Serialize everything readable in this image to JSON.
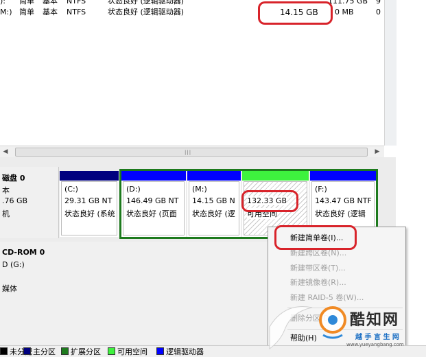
{
  "volumes": [
    {
      "name": "):",
      "layout": "简单",
      "type": "基本",
      "fs": "NTFS",
      "status": "状态良好 (逻辑驱动器)",
      "capacity": "",
      "free": "111.75 GB",
      "pct": "9"
    },
    {
      "name": "M:)",
      "layout": "简单",
      "type": "基本",
      "fs": "NTFS",
      "status": "状态良好 (逻辑驱动器)",
      "capacity": "14.15 GB",
      "free": "0 MB",
      "pct": "0"
    }
  ],
  "disks": {
    "disk0": {
      "title": "磁盘 0",
      "line1": "本",
      "line2": ".76 GB",
      "line3": "机"
    },
    "cdrom": {
      "title": "CD-ROM 0",
      "line1": "D (G:)",
      "line2": "",
      "line3": "媒体"
    }
  },
  "partitions": [
    {
      "label": "(C:)",
      "size": "29.31 GB NT",
      "status": "状态良好 (系统"
    },
    {
      "label": "(D:)",
      "size": "146.49 GB NT",
      "status": "状态良好 (页面"
    },
    {
      "label": "(M:)",
      "size": "14.15 GB N",
      "status": "状态良好 (逻"
    },
    {
      "label": "",
      "size": "132.33 GB",
      "status": "可用空间"
    },
    {
      "label": "(F:)",
      "size": "143.47 GB NTF",
      "status": "状态良好 (逻辑"
    }
  ],
  "context_menu": {
    "items": [
      {
        "label": "新建简单卷(I)...",
        "enabled": true
      },
      {
        "label": "新建跨区卷(N)...",
        "enabled": false
      },
      {
        "label": "新建带区卷(T)...",
        "enabled": false
      },
      {
        "label": "新建镜像卷(R)...",
        "enabled": false
      },
      {
        "label": "新建 RAID-5 卷(W)...",
        "enabled": false
      },
      {
        "label": "删除分区(D)",
        "enabled": false
      },
      {
        "label": "帮助(H)",
        "enabled": true
      }
    ]
  },
  "legend": [
    {
      "label": "未分配",
      "color": "#000000"
    },
    {
      "label": "主分区",
      "color": "#00007f"
    },
    {
      "label": "扩展分区",
      "color": "#1d7a1d"
    },
    {
      "label": "可用空间",
      "color": "#3ef23e"
    },
    {
      "label": "逻辑驱动器",
      "color": "#0000ff"
    }
  ],
  "watermark": {
    "brand": "酷知网",
    "tagline": "越 手 言 生 网",
    "url": "www.yueyangbang.com"
  },
  "colors": {
    "primary_bar": "#00007f",
    "logical_bar": "#0000ff",
    "free_bar": "#3ef23e",
    "extended_border": "#1d7a1d",
    "highlight": "#d8232a"
  }
}
